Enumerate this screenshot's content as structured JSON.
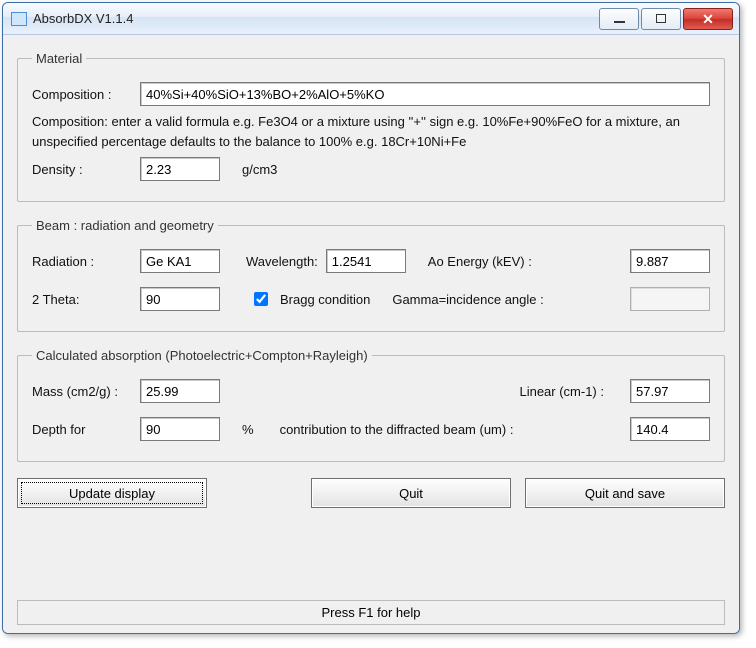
{
  "window": {
    "title": "AbsorbDX V1.1.4"
  },
  "material": {
    "legend": "Material",
    "composition_label": "Composition :",
    "composition_value": "40%Si+40%SiO+13%BO+2%AlO+5%KO",
    "hint": "Composition: enter a valid formula e.g. Fe3O4 or a mixture using ''+'' sign e.g. 10%Fe+90%FeO for a mixture, an unspecified percentage defaults to the balance to 100% e.g. 18Cr+10Ni+Fe",
    "density_label": "Density :",
    "density_value": "2.23",
    "density_units": "g/cm3"
  },
  "beam": {
    "legend": "Beam : radiation and geometry",
    "radiation_label": "Radiation :",
    "radiation_value": "Ge KA1",
    "wavelength_label": "Wavelength:",
    "wavelength_value": "1.2541",
    "ao_energy_label": "Ao  Energy (kEV) :",
    "ao_energy_value": "9.887",
    "two_theta_label": "2 Theta:",
    "two_theta_value": "90",
    "bragg_checked": true,
    "bragg_label": "Bragg condition",
    "gamma_label": "Gamma=incidence angle :",
    "gamma_value": ""
  },
  "calc": {
    "legend": "Calculated absorption (Photoelectric+Compton+Rayleigh)",
    "mass_label": "Mass (cm2/g) :",
    "mass_value": "25.99",
    "linear_label": "Linear (cm-1) :",
    "linear_value": "57.97",
    "depth_label": "Depth for",
    "depth_percent_value": "90",
    "depth_percent_unit": "%",
    "depth_trail": "contribution to the diffracted beam (um) :",
    "depth_value": "140.4"
  },
  "buttons": {
    "update": "Update display",
    "quit": "Quit",
    "quit_save": "Quit and save"
  },
  "status": "Press F1 for help"
}
